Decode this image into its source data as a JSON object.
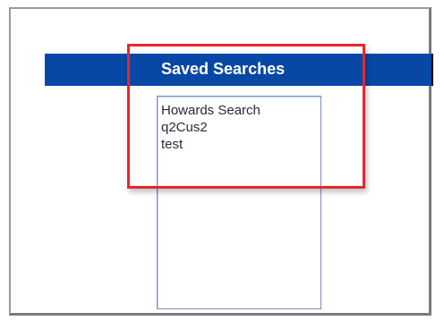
{
  "panel": {
    "title": "Saved Searches"
  },
  "saved_searches": {
    "items": [
      {
        "label": "Howards Search"
      },
      {
        "label": "q2Cus2"
      },
      {
        "label": "test"
      }
    ]
  },
  "colors": {
    "header_bar": "#0748a6",
    "highlight_border": "#e8262e",
    "listbox_border": "#7a8fb8"
  }
}
